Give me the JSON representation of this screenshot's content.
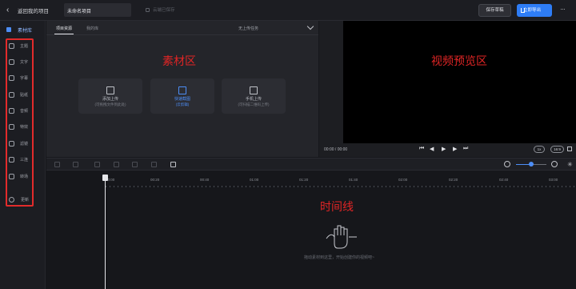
{
  "topbar": {
    "back_label": "返回我的项目",
    "title_value": "未命名项目",
    "save_status": "云端已保存",
    "draft_button": "保存草稿",
    "export_button": "立即导出"
  },
  "sidebar": {
    "header_label": "素材库",
    "items": [
      {
        "label": "主题",
        "icon": "theme-icon"
      },
      {
        "label": "文字",
        "icon": "text-icon"
      },
      {
        "label": "字幕",
        "icon": "subtitle-icon"
      },
      {
        "label": "贴纸",
        "icon": "sticker-icon"
      },
      {
        "label": "音频",
        "icon": "audio-icon"
      },
      {
        "label": "特效",
        "icon": "effect-icon"
      },
      {
        "label": "滤镜",
        "icon": "filter-icon"
      },
      {
        "label": "三连",
        "icon": "thumbs-up-icon"
      },
      {
        "label": "转场",
        "icon": "transition-icon"
      }
    ],
    "settings_label": "更新"
  },
  "material": {
    "tabs": [
      "项目资源",
      "我的库"
    ],
    "upload_dropdown": "无上传任务",
    "region_label": "素材区",
    "cards": [
      {
        "title": "添加上传",
        "subtitle": "(可拖拽文件到此处)",
        "highlight": false
      },
      {
        "title": "快速截图",
        "subtitle": "(云剪辑)",
        "highlight": true
      },
      {
        "title": "手机上传",
        "subtitle": "(可扫描二维码上传)",
        "highlight": false
      }
    ]
  },
  "preview": {
    "region_label": "视频预览区",
    "time_current": "00:00",
    "time_total": "00:00",
    "speed": "1x",
    "ratio": "16:9"
  },
  "timeline": {
    "region_label": "时间线",
    "ruler_labels": [
      "00:00",
      "00:20",
      "00:40",
      "01:00",
      "01:20",
      "01:40",
      "02:00",
      "02:20",
      "02:40",
      "03:00"
    ],
    "empty_hint": "拖动素材到这里，开始创建你的视频吧~"
  },
  "colors": {
    "accent": "#2e7df6",
    "annotation_red": "#e02525"
  }
}
